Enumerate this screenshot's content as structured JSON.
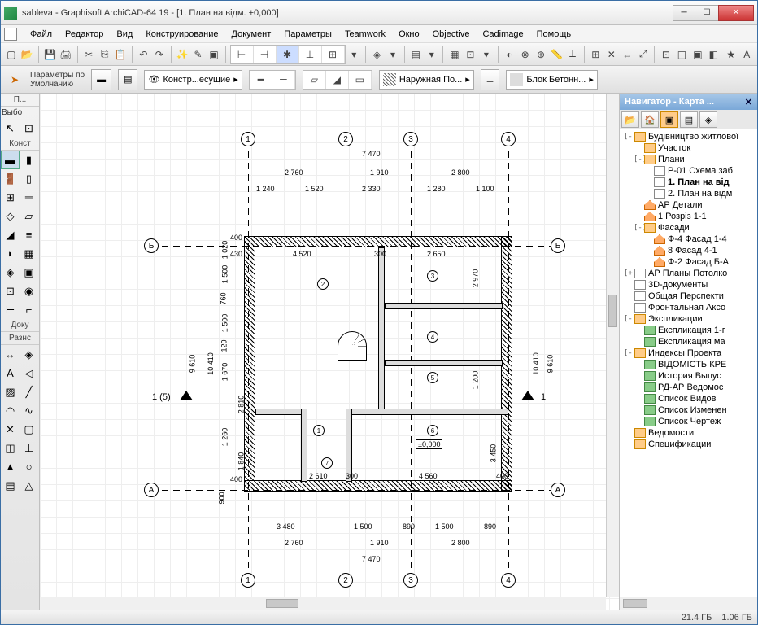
{
  "title": "sableva - Graphisoft ArchiCAD-64 19 - [1. План на відм. +0,000]",
  "menu": [
    "Файл",
    "Редактор",
    "Вид",
    "Конструирование",
    "Документ",
    "Параметры",
    "Teamwork",
    "Окно",
    "Objective",
    "Cadimage",
    "Помощь"
  ],
  "infobar": {
    "defaults_label": "Параметры по\nУмолчанию",
    "layer_label": "Констр...есущие",
    "wall_label": "Наружная По...",
    "material_label": "Блок Бетонн..."
  },
  "toolbox": {
    "hdr1": "П...",
    "lbl1": "Выбо",
    "hdr2": "Конст",
    "hdr3": "Доку",
    "hdr4": "Разнс"
  },
  "navigator": {
    "title": "Навигатор - Карта ...",
    "tree": [
      {
        "ind": 0,
        "exp": "-",
        "ico": "folder",
        "label": "Будівництво житлової"
      },
      {
        "ind": 1,
        "exp": "",
        "ico": "folder",
        "label": "Участок"
      },
      {
        "ind": 1,
        "exp": "-",
        "ico": "folder",
        "label": "Плани"
      },
      {
        "ind": 2,
        "exp": "",
        "ico": "doc",
        "label": "Р-01 Схема заб"
      },
      {
        "ind": 2,
        "exp": "",
        "ico": "doc",
        "label": "1. План на від",
        "sel": true
      },
      {
        "ind": 2,
        "exp": "",
        "ico": "doc",
        "label": "2. План на відм"
      },
      {
        "ind": 1,
        "exp": "",
        "ico": "house",
        "label": "АР Детали"
      },
      {
        "ind": 1,
        "exp": "",
        "ico": "house",
        "label": "1 Розріз 1-1"
      },
      {
        "ind": 1,
        "exp": "-",
        "ico": "folder",
        "label": "Фасади"
      },
      {
        "ind": 2,
        "exp": "",
        "ico": "house",
        "label": "Ф-4 Фасад 1-4"
      },
      {
        "ind": 2,
        "exp": "",
        "ico": "house",
        "label": "8 Фасад 4-1"
      },
      {
        "ind": 2,
        "exp": "",
        "ico": "house",
        "label": "Ф-2 Фасад Б-А"
      },
      {
        "ind": 0,
        "exp": "+",
        "ico": "doc",
        "label": "АР Планы Потолко"
      },
      {
        "ind": 0,
        "exp": "",
        "ico": "doc",
        "label": "3D-документы"
      },
      {
        "ind": 0,
        "exp": "",
        "ico": "doc",
        "label": "Общая Перспекти"
      },
      {
        "ind": 0,
        "exp": "",
        "ico": "doc",
        "label": "Фронтальная Аксо"
      },
      {
        "ind": 0,
        "exp": "-",
        "ico": "folder",
        "label": "Экспликации"
      },
      {
        "ind": 1,
        "exp": "",
        "ico": "sheet",
        "label": "Експликация 1-г"
      },
      {
        "ind": 1,
        "exp": "",
        "ico": "sheet",
        "label": "Експликация ма"
      },
      {
        "ind": 0,
        "exp": "-",
        "ico": "folder",
        "label": "Индексы Проекта"
      },
      {
        "ind": 1,
        "exp": "",
        "ico": "sheet",
        "label": "ВІДОМІСТЬ КРЕ"
      },
      {
        "ind": 1,
        "exp": "",
        "ico": "sheet",
        "label": "История Выпус"
      },
      {
        "ind": 1,
        "exp": "",
        "ico": "sheet",
        "label": "РД-АР Ведомос"
      },
      {
        "ind": 1,
        "exp": "",
        "ico": "sheet",
        "label": "Список Видов"
      },
      {
        "ind": 1,
        "exp": "",
        "ico": "sheet",
        "label": "Список Изменен"
      },
      {
        "ind": 1,
        "exp": "",
        "ico": "sheet",
        "label": "Список Чертеж"
      },
      {
        "ind": 0,
        "exp": "",
        "ico": "folder",
        "label": "Ведомости"
      },
      {
        "ind": 0,
        "exp": "",
        "ico": "folder",
        "label": "Спецификации"
      }
    ]
  },
  "plan": {
    "axes_h": {
      "labels": [
        "1",
        "2",
        "3",
        "4"
      ]
    },
    "axes_v": {
      "labels": [
        "А",
        "Б"
      ]
    },
    "section": {
      "left": "1 (5)",
      "right": "1"
    },
    "rooms": [
      "1",
      "2",
      "3",
      "4",
      "5",
      "6",
      "7"
    ],
    "level_mark": "±0,000",
    "dims_top": {
      "total": "7 470",
      "row2": [
        "2 760",
        "1 910",
        "2 800"
      ],
      "row3": [
        "1 240",
        "1 520",
        "2 330",
        "1 280",
        "1 100"
      ]
    },
    "dims_bottom": {
      "row1": [
        "3 480",
        "1 500",
        "890",
        "1 500",
        "890"
      ],
      "row2": [
        "2 760",
        "1 910",
        "2 800"
      ],
      "total": "7 470"
    },
    "dims_left": {
      "total": "9 610",
      "col": "10 410",
      "segs": [
        "1 020",
        "1 500",
        "760",
        "1 500",
        "120",
        "1 670",
        "2 810",
        "1 260",
        "1 840"
      ],
      "extra": [
        "400",
        "430",
        "400",
        "900"
      ]
    },
    "dims_right": {
      "col": "10 410",
      "total": "9 610",
      "segs": [
        "2 970",
        "1 200",
        "3 450"
      ]
    },
    "dims_inner": [
      "4 520",
      "300",
      "2 650",
      "300",
      "2 610",
      "300",
      "4 560",
      "400",
      "400",
      "400",
      "400"
    ]
  },
  "status": {
    "mem1": "21.4 ГБ",
    "mem2": "1.06 ГБ"
  }
}
